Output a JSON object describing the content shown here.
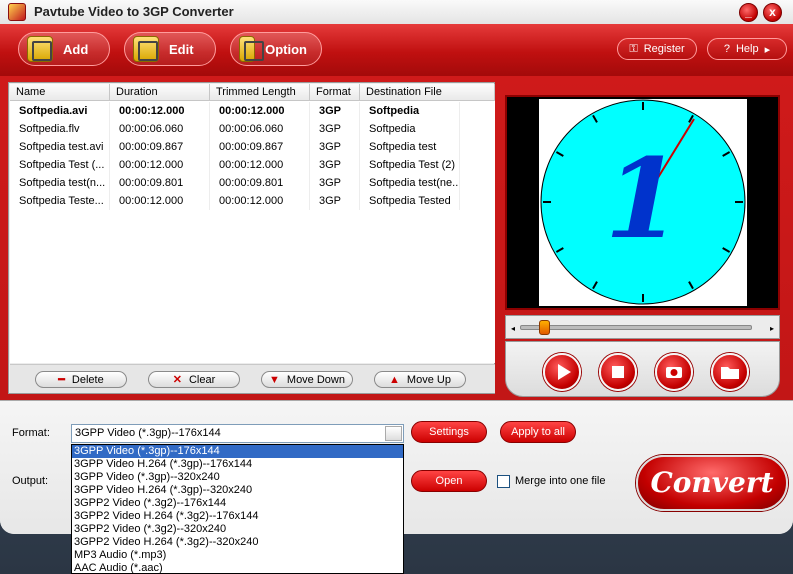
{
  "window": {
    "title": "Pavtube Video to 3GP Converter",
    "minimize": "_",
    "close": "x"
  },
  "toolbar": {
    "add": "Add",
    "edit": "Edit",
    "option": "Option",
    "register": "Register",
    "help": "Help"
  },
  "table": {
    "columns": [
      "Name",
      "Duration",
      "Trimmed Length",
      "Format",
      "Destination File"
    ],
    "rows": [
      {
        "name": "Softpedia.avi",
        "duration": "00:00:12.000",
        "trimmed": "00:00:12.000",
        "format": "3GP",
        "dest": "Softpedia"
      },
      {
        "name": "Softpedia.flv",
        "duration": "00:00:06.060",
        "trimmed": "00:00:06.060",
        "format": "3GP",
        "dest": "Softpedia"
      },
      {
        "name": "Softpedia test.avi",
        "duration": "00:00:09.867",
        "trimmed": "00:00:09.867",
        "format": "3GP",
        "dest": "Softpedia test"
      },
      {
        "name": "Softpedia Test (...",
        "duration": "00:00:12.000",
        "trimmed": "00:00:12.000",
        "format": "3GP",
        "dest": "Softpedia Test (2)"
      },
      {
        "name": "Softpedia test(n...",
        "duration": "00:00:09.801",
        "trimmed": "00:00:09.801",
        "format": "3GP",
        "dest": "Softpedia test(ne..."
      },
      {
        "name": "Softpedia Teste...",
        "duration": "00:00:12.000",
        "trimmed": "00:00:12.000",
        "format": "3GP",
        "dest": "Softpedia Tested"
      }
    ]
  },
  "actions": {
    "delete": "Delete",
    "clear": "Clear",
    "move_down": "Move Down",
    "move_up": "Move Up"
  },
  "player": {
    "clock_digit": "1",
    "seek_position": 0.08
  },
  "bottom": {
    "format_label": "Format:",
    "output_label": "Output:",
    "format_value": "3GPP Video (*.3gp)--176x144",
    "settings": "Settings",
    "apply_all": "Apply to all",
    "open": "Open",
    "merge": "Merge into one file",
    "convert": "Convert"
  },
  "dropdown_options": [
    "3GPP Video (*.3gp)--176x144",
    "3GPP Video H.264 (*.3gp)--176x144",
    "3GPP Video (*.3gp)--320x240",
    "3GPP Video H.264 (*.3gp)--320x240",
    "3GPP2 Video (*.3g2)--176x144",
    "3GPP2 Video H.264 (*.3g2)--176x144",
    "3GPP2 Video (*.3g2)--320x240",
    "3GPP2 Video H.264 (*.3g2)--320x240",
    "MP3 Audio (*.mp3)",
    "AAC Audio (*.aac)"
  ],
  "colors": {
    "accent": "#c01010",
    "clock_face": "#00ffff",
    "selection": "#316ac5"
  }
}
